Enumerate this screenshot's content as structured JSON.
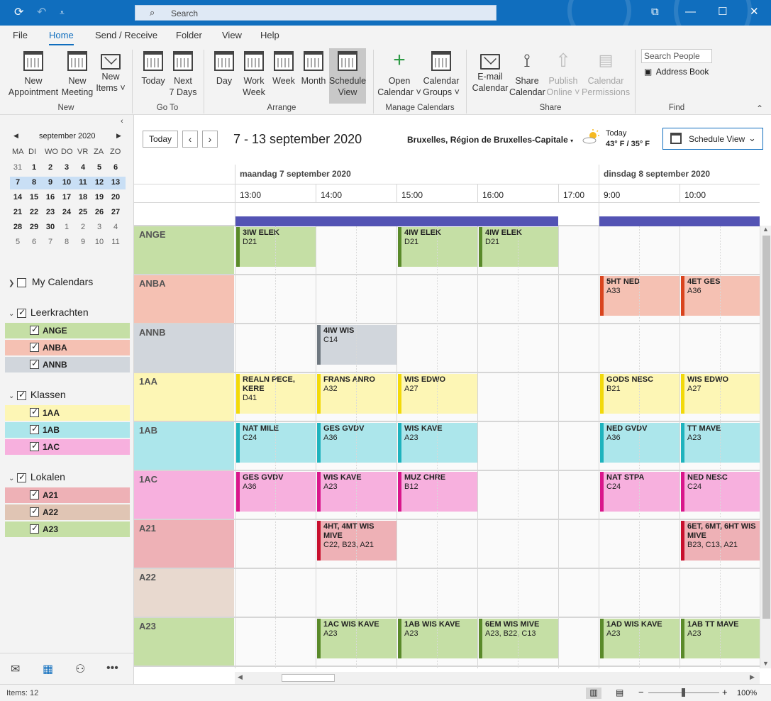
{
  "titlebar": {
    "search_placeholder": "Search",
    "icons": [
      "refresh-icon",
      "undo-icon",
      "customize-icon",
      "restore-icon",
      "minimize-icon",
      "maximize-icon",
      "close-icon"
    ]
  },
  "menu_tabs": [
    "File",
    "Home",
    "Send / Receive",
    "Folder",
    "View",
    "Help"
  ],
  "ribbon": {
    "groups": {
      "new": "New",
      "goto": "Go To",
      "arrange": "Arrange",
      "manage": "Manage Calendars",
      "share": "Share",
      "find": "Find"
    },
    "buttons": {
      "new_appointment": [
        "New",
        "Appointment"
      ],
      "new_meeting": [
        "New",
        "Meeting"
      ],
      "new_items": [
        "New",
        "Items ˅"
      ],
      "today": [
        "Today",
        ""
      ],
      "next7": [
        "Next",
        "7 Days"
      ],
      "day": [
        "Day",
        ""
      ],
      "work_week": [
        "Work",
        "Week"
      ],
      "week": [
        "Week",
        ""
      ],
      "month": [
        "Month",
        ""
      ],
      "schedule_view": [
        "Schedule",
        "View"
      ],
      "open_calendar": [
        "Open",
        "Calendar ˅"
      ],
      "calendar_groups": [
        "Calendar",
        "Groups ˅"
      ],
      "email_calendar": [
        "E-mail",
        "Calendar"
      ],
      "share_calendar": [
        "Share",
        "Calendar"
      ],
      "publish_online": [
        "Publish",
        "Online ˅"
      ],
      "calendar_permissions": [
        "Calendar",
        "Permissions"
      ]
    },
    "search_people_placeholder": "Search People",
    "address_book": "Address Book"
  },
  "mini_calendar": {
    "month": "september 2020",
    "dow": [
      "MA",
      "DI",
      "WO",
      "DO",
      "VR",
      "ZA",
      "ZO"
    ],
    "weeks": [
      [
        "31",
        "1",
        "2",
        "3",
        "4",
        "5",
        "6"
      ],
      [
        "7",
        "8",
        "9",
        "10",
        "11",
        "12",
        "13"
      ],
      [
        "14",
        "15",
        "16",
        "17",
        "18",
        "19",
        "20"
      ],
      [
        "21",
        "22",
        "23",
        "24",
        "25",
        "26",
        "27"
      ],
      [
        "28",
        "29",
        "30",
        "1",
        "2",
        "3",
        "4"
      ],
      [
        "5",
        "6",
        "7",
        "8",
        "9",
        "10",
        "11"
      ]
    ]
  },
  "nav": {
    "my_calendars": "My Calendars",
    "groups": [
      {
        "label": "Leerkrachten",
        "items": [
          {
            "label": "ANGE",
            "color": "#c5dfa5"
          },
          {
            "label": "ANBA",
            "color": "#f5c1b3"
          },
          {
            "label": "ANNB",
            "color": "#d1d6dc"
          }
        ]
      },
      {
        "label": "Klassen",
        "items": [
          {
            "label": "1AA",
            "color": "#fdf6b5"
          },
          {
            "label": "1AB",
            "color": "#ace6eb"
          },
          {
            "label": "1AC",
            "color": "#f7b0de"
          }
        ]
      },
      {
        "label": "Lokalen",
        "items": [
          {
            "label": "A21",
            "color": "#eeb1b6"
          },
          {
            "label": "A22",
            "color": "#e0c5b4"
          },
          {
            "label": "A23",
            "color": "#c5dfa5"
          }
        ]
      }
    ]
  },
  "toolbar": {
    "today": "Today",
    "date_range": "7 - 13 september 2020",
    "location": "Bruxelles, Région de Bruxelles-Capitale",
    "weather_label": "Today",
    "weather_temp": "43° F / 35° F",
    "view_button": "Schedule View"
  },
  "schedule": {
    "days": [
      "maandag 7 september 2020",
      "dinsdag 8 september 2020"
    ],
    "times": [
      "13:00",
      "14:00",
      "15:00",
      "16:00",
      "17:00",
      "9:00",
      "10:00"
    ],
    "rows": [
      {
        "name": "ANGE",
        "bg": "#c5dfa5",
        "accent": "#5a8a2a",
        "events": [
          {
            "slot": 0,
            "title": "3IW ELEK",
            "loc": "D21"
          },
          {
            "slot": 2,
            "title": "4IW ELEK",
            "loc": "D21"
          },
          {
            "slot": 3,
            "title": "4IW ELEK",
            "loc": "D21"
          }
        ]
      },
      {
        "name": "ANBA",
        "bg": "#f5c1b3",
        "accent": "#d9441e",
        "events": [
          {
            "slot": 5,
            "title": "5HT NED",
            "loc": "A33"
          },
          {
            "slot": 6,
            "title": "4ET GES",
            "loc": "A36"
          }
        ]
      },
      {
        "name": "ANNB",
        "bg": "#d1d6dc",
        "accent": "#6f7880",
        "events": [
          {
            "slot": 1,
            "title": "4IW WIS",
            "loc": "C14"
          }
        ]
      },
      {
        "name": "1AA",
        "bg": "#fdf6b5",
        "accent": "#f2d90a",
        "events": [
          {
            "slot": 0,
            "title": "REALN PECE, KERE",
            "loc": "D41"
          },
          {
            "slot": 1,
            "title": "FRANS ANRO",
            "loc": "A32"
          },
          {
            "slot": 2,
            "title": "WIS EDWO",
            "loc": "A27"
          },
          {
            "slot": 5,
            "title": "GODS NESC",
            "loc": "B21"
          },
          {
            "slot": 6,
            "title": "WIS EDWO",
            "loc": "A27"
          }
        ]
      },
      {
        "name": "1AB",
        "bg": "#ace6eb",
        "accent": "#1eb3bd",
        "events": [
          {
            "slot": 0,
            "title": "NAT MILE",
            "loc": "C24"
          },
          {
            "slot": 1,
            "title": "GES GVDV",
            "loc": "A36"
          },
          {
            "slot": 2,
            "title": "WIS KAVE",
            "loc": "A23"
          },
          {
            "slot": 5,
            "title": "NED GVDV",
            "loc": "A36"
          },
          {
            "slot": 6,
            "title": "TT MAVE",
            "loc": "A23"
          }
        ]
      },
      {
        "name": "1AC",
        "bg": "#f7b0de",
        "accent": "#d9168b",
        "events": [
          {
            "slot": 0,
            "title": "GES GVDV",
            "loc": "A36"
          },
          {
            "slot": 1,
            "title": "WIS KAVE",
            "loc": "A23"
          },
          {
            "slot": 2,
            "title": "MUZ CHRE",
            "loc": "B12"
          },
          {
            "slot": 5,
            "title": "NAT STPA",
            "loc": "C24"
          },
          {
            "slot": 6,
            "title": "NED NESC",
            "loc": "C24"
          }
        ]
      },
      {
        "name": "A21",
        "bg": "#eeb1b6",
        "accent": "#c8102e",
        "events": [
          {
            "slot": 1,
            "title": "4HT, 4MT WIS MIVE",
            "loc": "C22, B23, A21"
          },
          {
            "slot": 6,
            "title": "6ET, 6MT, 6HT WIS MIVE",
            "loc": "B23, C13, A21"
          }
        ]
      },
      {
        "name": "A22",
        "bg": "#e8d9cf",
        "accent": "#a56b46",
        "events": []
      },
      {
        "name": "A23",
        "bg": "#c5dfa5",
        "accent": "#5a8a2a",
        "events": [
          {
            "slot": 1,
            "title": "1AC WIS KAVE",
            "loc": "A23"
          },
          {
            "slot": 2,
            "title": "1AB WIS KAVE",
            "loc": "A23"
          },
          {
            "slot": 3,
            "title": "6EM WIS MIVE",
            "loc": "A23, B22, C13"
          },
          {
            "slot": 5,
            "title": "1AD WIS KAVE",
            "loc": "A23"
          },
          {
            "slot": 6,
            "title": "1AB TT MAVE",
            "loc": "A23"
          }
        ]
      }
    ]
  },
  "status": {
    "items": "Items: 12",
    "zoom": "100%"
  },
  "colors": {
    "accent": "#106ebe",
    "allday_bar": "#5353b4"
  }
}
